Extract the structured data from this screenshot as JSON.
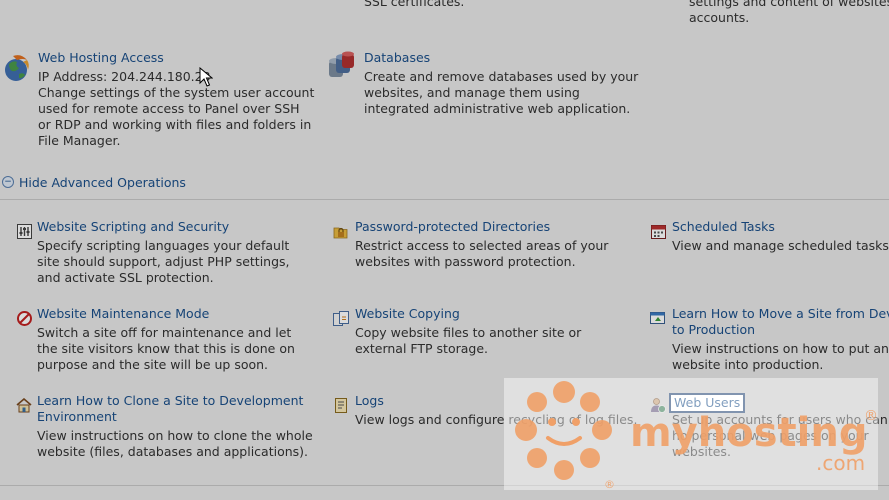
{
  "top_fragments": {
    "ssl": "SSL certificates.",
    "right_line1": "settings and content of websites a",
    "right_line2": "accounts."
  },
  "web_hosting_access": {
    "title": "Web Hosting Access",
    "ip": "IP Address: 204.244.180.23",
    "desc": "Change settings of the system user account used for remote access to Panel over SSH or RDP and working with files and folders in File Manager."
  },
  "databases": {
    "title": "Databases",
    "desc": "Create and remove databases used by your websites, and manage them using integrated administrative web application."
  },
  "advanced_toggle": {
    "icon": "minus",
    "label": "Hide Advanced Operations"
  },
  "operations": [
    {
      "title": "Website Scripting and Security",
      "desc": "Specify scripting languages your default site should support, adjust PHP settings, and activate SSL protection.",
      "icon": "sliders-icon"
    },
    {
      "title": "Password-protected Directories",
      "desc": "Restrict access to selected areas of your websites with password protection.",
      "icon": "lock-folder-icon"
    },
    {
      "title": "Scheduled Tasks",
      "desc": "View and manage scheduled tasks.",
      "icon": "calendar-icon"
    },
    {
      "title": "Website Maintenance Mode",
      "desc": "Switch a site off for maintenance and let the site visitors know that this is done on purpose and the site will be up soon.",
      "icon": "no-entry-icon"
    },
    {
      "title": "Website Copying",
      "desc": "Copy website files to another site or external FTP storage.",
      "icon": "copy-icon"
    },
    {
      "title": "Learn How to Move a Site from Deve",
      "title2": "to Production",
      "desc": "View instructions on how to put an up website into production.",
      "icon": "move-site-icon"
    },
    {
      "title": "Learn How to Clone a Site to Development",
      "title2": "Environment",
      "desc": "View instructions on how to clone the whole website (files, databases and applications).",
      "icon": "clone-site-icon"
    },
    {
      "title": "Logs",
      "desc": "View logs and configure recycling of log files.",
      "icon": "log-icon"
    },
    {
      "title": "Web Users",
      "desc": "Set up accounts for users who can ho personal web pages on your websites.",
      "icon": "web-user-icon"
    }
  ],
  "watermark": {
    "brand": "myhosting",
    "suffix": ".com",
    "registered": "®"
  },
  "colors": {
    "link": "#1a4f8a",
    "text": "#333333",
    "background": "#e8e8e8",
    "watermark_orange": "#f0a068"
  }
}
